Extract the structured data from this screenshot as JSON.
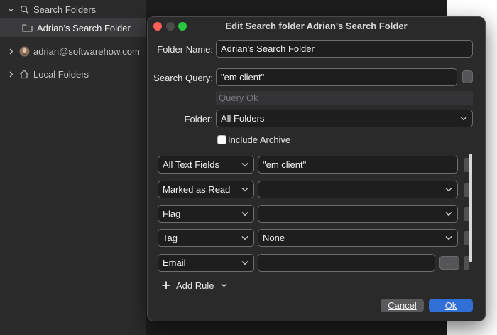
{
  "sidebar": {
    "items": [
      {
        "label": "Search Folders",
        "icon": "search-icon"
      },
      {
        "label": "Adrian's Search Folder",
        "icon": "folder-icon"
      },
      {
        "label": "adrian@softwarehow.com",
        "icon": "avatar"
      },
      {
        "label": "Local Folders",
        "icon": "home-icon"
      }
    ]
  },
  "dialog": {
    "title": "Edit Search folder Adrian's Search Folder",
    "folder_name_label": "Folder Name:",
    "folder_name_value": "Adrian's Search Folder",
    "search_query_label": "Search Query:",
    "search_query_value": "\"em client\"",
    "query_status": "Query Ok",
    "folder_label": "Folder:",
    "folder_value": "All Folders",
    "include_archive_label": "Include Archive",
    "include_archive_checked": false,
    "rules": [
      {
        "field": "All Text Fields",
        "value": "\"em client\"",
        "value_type": "text"
      },
      {
        "field": "Marked as Read",
        "value": "",
        "value_type": "select"
      },
      {
        "field": "Flag",
        "value": "",
        "value_type": "select"
      },
      {
        "field": "Tag",
        "value": "None",
        "value_type": "select"
      },
      {
        "field": "Email",
        "value": "",
        "value_type": "text-with-browse",
        "browse_label": "..."
      }
    ],
    "add_rule_label": "Add Rule",
    "cancel_label": "Cancel",
    "ok_label": "Ok"
  },
  "colors": {
    "accent": "#2f6fd6",
    "close": "#ff5f57",
    "minimize_inactive": "#4a4a4c",
    "zoom": "#28c840"
  }
}
